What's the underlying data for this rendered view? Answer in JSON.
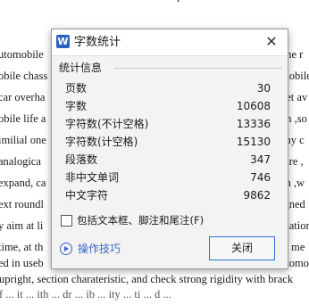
{
  "background_doc": {
    "top_fragment": "r",
    "lines": [
      {
        "left": "utomobile",
        "right": "one r"
      },
      {
        "left": "obile chass",
        "right": "mobile"
      },
      {
        "left": "car overha",
        "right": "get av"
      },
      {
        "left": "obile life a",
        "right": "on ,so"
      },
      {
        "left": "imilial one",
        "right": "any c"
      },
      {
        "left": "analogica",
        "right": "ture ,"
      },
      {
        "left": "expand, ca",
        "right": "en ,w"
      },
      {
        "left": "ext roundl",
        "right": "igned"
      },
      {
        "left": "y aim at li",
        "right": "mation"
      },
      {
        "left": "time, at th",
        "right": "al me"
      },
      {
        "left": "ed in useb",
        "right": "utomol"
      }
    ],
    "full_line": "upright, section charateristic, and check strong rigidity with brack",
    "bottom_fragment": "f ... it ... ith ... dr ... ib ... ity ... ti ... d ..."
  },
  "dialog": {
    "title": "字数统计",
    "app_icon_letter": "W",
    "close_glyph": "✕",
    "group_label": "统计信息",
    "stats": [
      {
        "label": "页数",
        "value": "30"
      },
      {
        "label": "字数",
        "value": "10608"
      },
      {
        "label": "字符数(不计空格)",
        "value": "13336"
      },
      {
        "label": "字符数(计空格)",
        "value": "15130"
      },
      {
        "label": "段落数",
        "value": "347"
      },
      {
        "label": "非中文单词",
        "value": "746"
      },
      {
        "label": "中文字符",
        "value": "9862"
      }
    ],
    "checkbox_label": "包括文本框、脚注和尾注(F)",
    "checkbox_checked": false,
    "tips_label": "操作技巧",
    "close_button_label": "关闭"
  },
  "colors": {
    "accent": "#2f6fd1",
    "link": "#3a66c8",
    "dialog_bg": "#f3f3f3",
    "app_icon": "#2f5ec4"
  },
  "icons": [
    "app-w-icon",
    "close-icon",
    "play-circle-icon",
    "checkbox"
  ]
}
